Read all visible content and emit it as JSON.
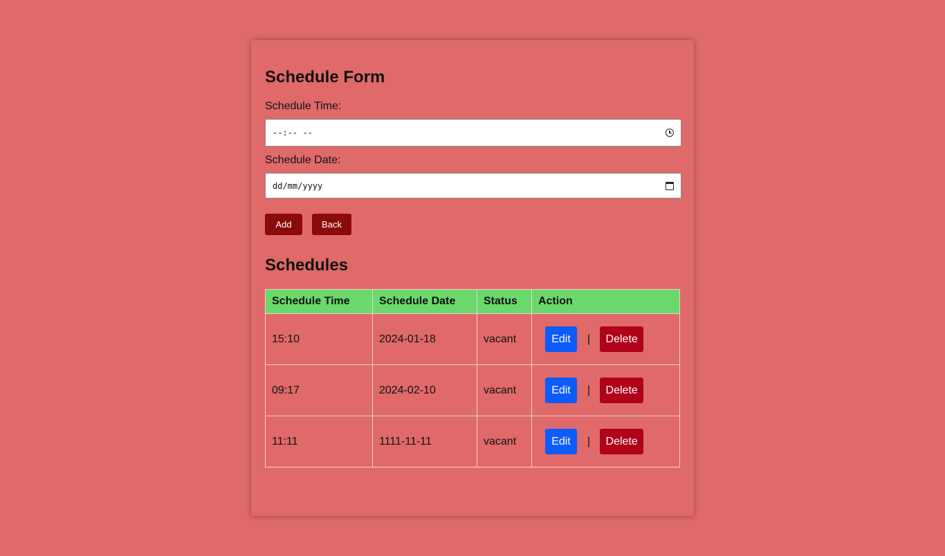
{
  "form": {
    "title": "Schedule Form",
    "time_label": "Schedule Time:",
    "time_placeholder": "--:-- --",
    "date_label": "Schedule Date:",
    "date_placeholder": "dd/mm/yyyy",
    "add_label": "Add",
    "back_label": "Back"
  },
  "list": {
    "title": "Schedules",
    "columns": [
      "Schedule Time",
      "Schedule Date",
      "Status",
      "Action"
    ],
    "rows": [
      {
        "time": "15:10",
        "date": "2024-01-18",
        "status": "vacant",
        "edit": "Edit",
        "sep": "|",
        "delete": "Delete"
      },
      {
        "time": "09:17",
        "date": "2024-02-10",
        "status": "vacant",
        "edit": "Edit",
        "sep": "|",
        "delete": "Delete"
      },
      {
        "time": "11:11",
        "date": "1111-11-11",
        "status": "vacant",
        "edit": "Edit",
        "sep": "|",
        "delete": "Delete"
      }
    ]
  },
  "colors": {
    "background": "#e06969",
    "header_row": "#6ad86a",
    "dark_button": "#8b0a0a",
    "edit_button": "#0b5bff",
    "delete_button": "#b00219"
  },
  "icons": {
    "time_input": "clock-icon",
    "date_input": "calendar-icon"
  }
}
